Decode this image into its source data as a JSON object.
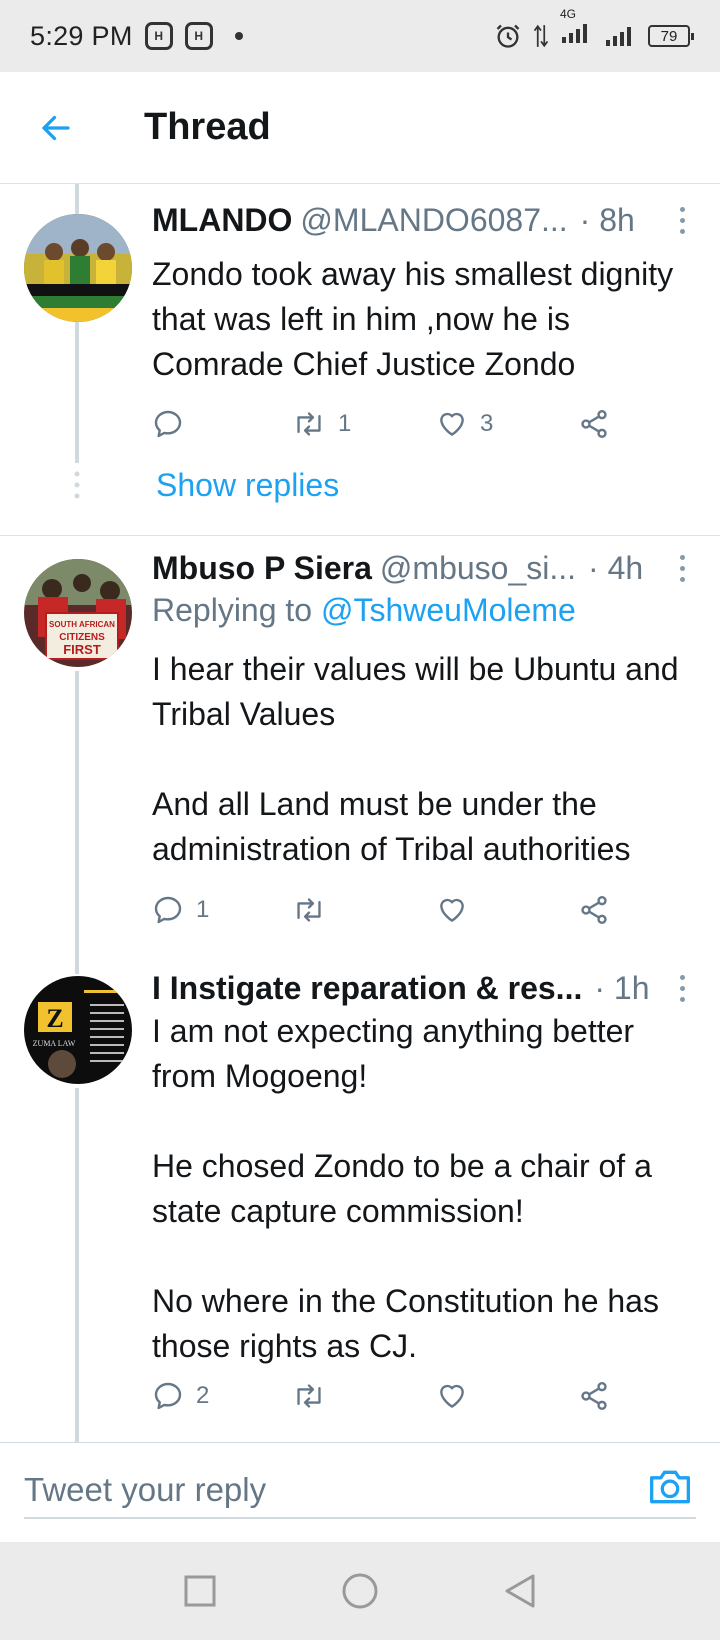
{
  "status_bar": {
    "time": "5:29 PM",
    "network": "4G",
    "battery": "79"
  },
  "header": {
    "title": "Thread"
  },
  "tweets": [
    {
      "name": "MLANDO",
      "handle": "@MLANDO6087...",
      "time": "· 8h",
      "text": "Zondo took away his smallest dignity that was left in him ,now he is Comrade Chief Justice Zondo",
      "replies": "",
      "retweets": "1",
      "likes": "3",
      "show_replies": "Show replies"
    },
    {
      "name": "Mbuso P Siera",
      "handle": "@mbuso_si...",
      "time": "· 4h",
      "replying_prefix": "Replying to",
      "replying_to": "@TshweuMoleme",
      "text": "I hear their values will be Ubuntu and Tribal Values\n\nAnd all Land must be under the administration of Tribal authorities",
      "replies": "1",
      "retweets": "",
      "likes": ""
    },
    {
      "name": "I Instigate reparation & res...",
      "handle": "",
      "time": "· 1h",
      "text": "I am not expecting anything better from Mogoeng!\n\nHe chosed Zondo to be a chair of a state capture commission!\n\nNo where in the Constitution he has those rights as CJ.",
      "replies": "2",
      "retweets": "",
      "likes": ""
    }
  ],
  "avatar_text": {
    "tweet2": [
      "SOUTH AFRICAN",
      "CITIZENS",
      "FIRST"
    ],
    "tweet3": [
      "Z",
      "ZUMA LAW"
    ]
  },
  "reply_bar": {
    "placeholder": "Tweet your reply"
  },
  "colors": {
    "accent": "#1da1f2",
    "secondary_text": "#657786",
    "primary_text": "#14171a",
    "thread_line": "#cfd9de"
  }
}
